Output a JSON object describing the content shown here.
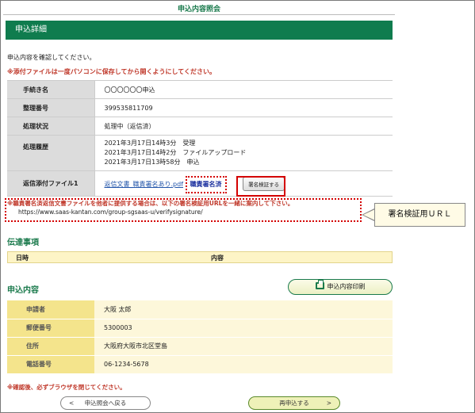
{
  "header": {
    "title": "申込内容照会"
  },
  "detail_section": {
    "title": "申込詳細"
  },
  "intro": "申込内容を確認してください。",
  "warning_top": "※添付ファイルは一度パソコンに保存してから開くようにしてください。",
  "detail_rows": {
    "procedure": {
      "label": "手続き名",
      "value": "〇〇〇〇〇〇申込"
    },
    "ref_no": {
      "label": "整理番号",
      "value": "399535811709"
    },
    "status": {
      "label": "処理状況",
      "value": "処理中（返信済）"
    },
    "history": {
      "label": "処理履歴",
      "lines": [
        "2021年3月17日14時3分　受理",
        "2021年3月17日14時2分　ファイルアップロード",
        "2021年3月17日13時58分　申込"
      ]
    },
    "reply_file": {
      "label": "返信添付ファイル1",
      "file_name": "返信文書_職責署名あり.pdf",
      "signature_status": "職責署名済",
      "verify_button": "署名検証する"
    }
  },
  "warning_signature": "※職責署名済返信文書ファイルを他者に提供する場合は、以下の署名検証用URLを一緒に案内して下さい。",
  "verify_url": "https://www.saas-kantan.com/group-sgsaas-u/verifysignature/",
  "callout": "署名検証用ＵＲＬ",
  "contact": {
    "title": "伝達事項",
    "col_date": "日時",
    "col_content": "内容"
  },
  "application": {
    "title": "申込内容",
    "print_button": "申込内容印刷",
    "rows": [
      {
        "label": "申請者",
        "value": "大阪 太郎"
      },
      {
        "label": "郵便番号",
        "value": "5300003"
      },
      {
        "label": "住所",
        "value": "大阪府大阪市北区堂島"
      },
      {
        "label": "電話番号",
        "value": "06-1234-5678"
      }
    ]
  },
  "warning_bottom": "※確認後、必ずブラウザを閉じてください。",
  "footer": {
    "back_button": "申込照会へ戻る",
    "reapply_button": "再申込する",
    "back_chevron": "<",
    "next_chevron": ">"
  },
  "colors": {
    "brand_green": "#0f7c4e",
    "warning_red": "#c0392b",
    "highlight_red": "#d40000"
  }
}
